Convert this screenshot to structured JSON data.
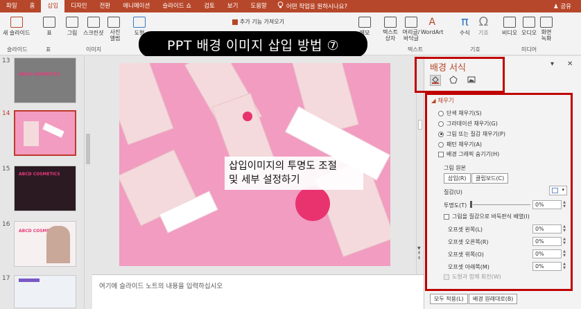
{
  "tabs": [
    "파일",
    "홈",
    "삽입",
    "디자인",
    "전환",
    "애니메이션",
    "슬라이드 쇼",
    "검토",
    "보기",
    "도움말"
  ],
  "active_tab": "삽입",
  "tell_me": "어떤 작업을 원하시나요?",
  "share": "공유",
  "ribbon": {
    "new_slide": "새 슬라이드",
    "slide_group": "슬라이드",
    "table": "표",
    "table_group": "표",
    "picture": "그림",
    "screenshot": "스크린샷",
    "album": "사진 앨범",
    "image_group": "이미지",
    "shapes": "도형",
    "addin": "추가 기능 가져오기",
    "comment": "메모",
    "textbox": "텍스트 상자",
    "header_footer": "머리글/ 바닥글",
    "wordart": "WordArt",
    "text_group": "텍스트",
    "equation": "수식",
    "symbol": "기호",
    "symbol_group": "기호",
    "video": "비디오",
    "audio": "오디오",
    "screen_record": "화면 녹화",
    "media_group": "미디어"
  },
  "banner": "PPT 배경 이미지 삽입 방법 ⑦",
  "thumbnails": [
    {
      "num": "13",
      "text": "ABCD COSMETICS"
    },
    {
      "num": "14",
      "text": ""
    },
    {
      "num": "15",
      "text": "ABCD COSMETICS"
    },
    {
      "num": "16",
      "text": "ABCD COSMETICS"
    },
    {
      "num": "17",
      "text": ""
    }
  ],
  "slide_overlay": "삽입이미지의 투명도 조절\n및 세부 설정하기",
  "notes_placeholder": "여기에 슬라이드 노트의 내용을 입력하십시오",
  "pane": {
    "title": "배경 서식",
    "fill_section": "채우기",
    "options": {
      "solid": "단색 채우기(S)",
      "gradient": "그라데이션 채우기(G)",
      "picture": "그림 또는 질감 채우기(P)",
      "pattern": "패턴 채우기(A)",
      "hide_bg": "배경 그래픽 숨기기(H)"
    },
    "picture_source": "그림 원본",
    "insert_btn": "삽입(R)",
    "clipboard_btn": "클립보드(C)",
    "texture": "질감(U)",
    "transparency": "투명도(T)",
    "transparency_value": "0%",
    "tile": "그림을 질감으로 바둑판식 배열(I)",
    "offset_left": "오프셋 왼쪽(L)",
    "offset_right": "오프셋 오른쪽(R)",
    "offset_top": "오프셋 위쪽(O)",
    "offset_bottom": "오프셋 아래쪽(M)",
    "offset_left_value": "0%",
    "offset_right_value": "0%",
    "offset_top_value": "0%",
    "offset_bottom_value": "0%",
    "rotate_with_shape": "도형과 함께 회전(W)",
    "apply_all": "모두 적용(L)",
    "reset_bg": "배경 원래대로(B)"
  },
  "colors": {
    "accent": "#b7472a",
    "highlight": "#c00000",
    "slide_bg": "#f19cc0"
  }
}
